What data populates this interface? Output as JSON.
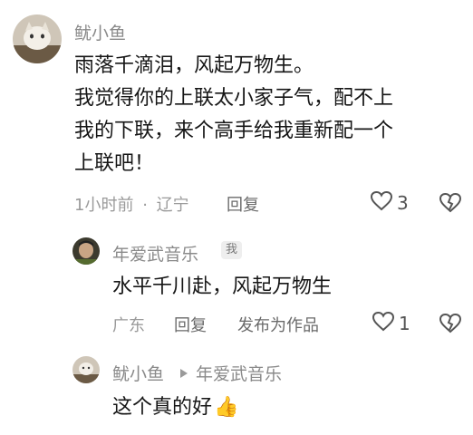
{
  "comment": {
    "author": "鱿小鱼",
    "lines": [
      "雨落千滴泪，风起万物生。",
      "我觉得你的上联太小家子气，配不上",
      "我的下联，来个高手给我重新配一个",
      "上联吧！"
    ],
    "time": "1小时前",
    "separator": "·",
    "location": "辽宁",
    "reply_label": "回复",
    "like_count": "3"
  },
  "reply1": {
    "author": "年爱武音乐",
    "badge": "我",
    "text": "水平千川赴，风起万物生",
    "location": "广东",
    "reply_label": "回复",
    "publish_label": "发布为作品",
    "like_count": "1"
  },
  "reply2": {
    "author": "鱿小鱼",
    "reply_to": "年爱武音乐",
    "text": "这个真的好",
    "emoji": "👍"
  },
  "icons": {
    "like": "heart-outline-icon",
    "dislike": "broken-heart-icon",
    "arrow": "triangle-right-icon"
  }
}
